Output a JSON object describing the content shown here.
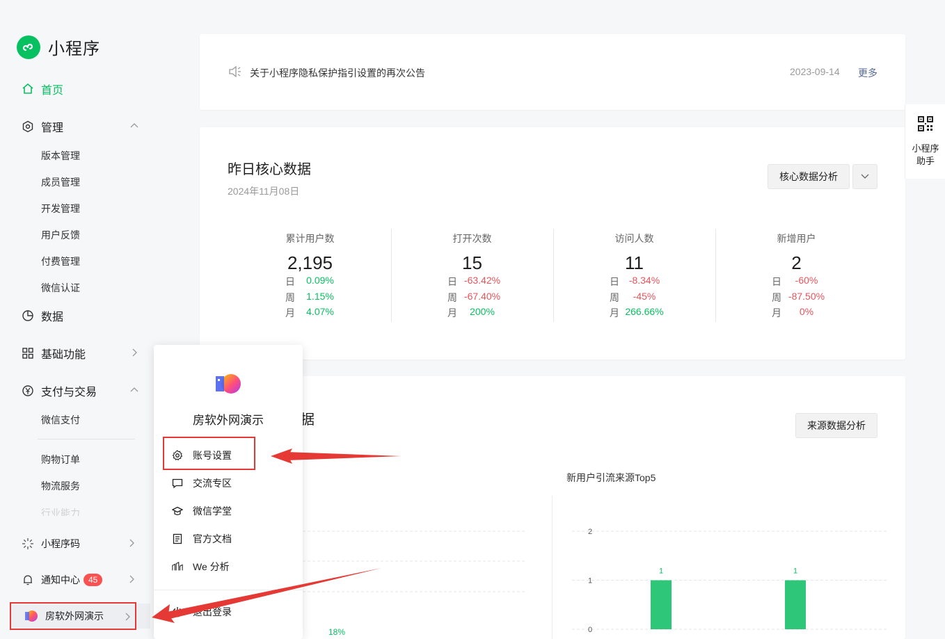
{
  "app": {
    "title": "小程序"
  },
  "sidebar": {
    "home": "首页",
    "manage": "管理",
    "manage_items": [
      "版本管理",
      "成员管理",
      "开发管理",
      "用户反馈",
      "付费管理",
      "微信认证"
    ],
    "data": "数据",
    "basic": "基础功能",
    "payment": "支付与交易",
    "payment_items": [
      "微信支付",
      "购物订单",
      "物流服务"
    ],
    "faded_item": "行业能力",
    "qrcode": "小程序码",
    "notify": "通知中心",
    "notify_count": "45",
    "account": "房软外网演示"
  },
  "notice": {
    "text": "关于小程序隐私保护指引设置的再次公告",
    "date": "2023-09-14",
    "more": "更多"
  },
  "core": {
    "title": "昨日核心数据",
    "date": "2024年11月08日",
    "analysis_button": "核心数据分析",
    "row_labels": [
      "日",
      "周",
      "月"
    ],
    "stats": [
      {
        "label": "累计用户数",
        "value": "2,195",
        "changes": [
          "0.09%",
          "1.15%",
          "4.07%"
        ],
        "trend": [
          "up",
          "up",
          "up"
        ]
      },
      {
        "label": "打开次数",
        "value": "15",
        "changes": [
          "-63.42%",
          "-67.40%",
          "200%"
        ],
        "trend": [
          "down",
          "down",
          "up"
        ]
      },
      {
        "label": "访问人数",
        "value": "11",
        "changes": [
          "-8.34%",
          "-45%",
          "266.66%"
        ],
        "trend": [
          "down",
          "down",
          "up"
        ]
      },
      {
        "label": "新增用户",
        "value": "2",
        "changes": [
          "-60%",
          "-87.50%",
          "0%"
        ],
        "trend": [
          "down",
          "down",
          "down"
        ]
      }
    ]
  },
  "source": {
    "title_visible": "据",
    "analysis_button": "来源数据分析",
    "left_pct": "18%",
    "top5_title": "新用户引流来源Top5"
  },
  "chart_data": {
    "type": "bar",
    "title": "新用户引流来源Top5",
    "categories": [
      "",
      ""
    ],
    "values": [
      1,
      1
    ],
    "ylim": [
      0,
      2
    ],
    "yticks": [
      0,
      1,
      2
    ],
    "data_labels": [
      "1",
      "1"
    ],
    "color": "#2ec77a",
    "grid": true
  },
  "assistant": {
    "label_line1": "小程序",
    "label_line2": "助手"
  },
  "popup": {
    "name": "房软外网演示",
    "items": [
      {
        "label": "账号设置",
        "icon": "gear-icon"
      },
      {
        "label": "交流专区",
        "icon": "chat-icon"
      },
      {
        "label": "微信学堂",
        "icon": "graduation-cap-icon"
      },
      {
        "label": "官方文档",
        "icon": "document-icon"
      },
      {
        "label": "We 分析",
        "icon": "analysis-icon"
      },
      {
        "label": "退出登录",
        "icon": "power-icon"
      }
    ]
  },
  "colors": {
    "brand": "#07c160",
    "up": "#07c160",
    "down": "#e8545b",
    "annotation": "#e53935",
    "badge": "#fa5151"
  }
}
